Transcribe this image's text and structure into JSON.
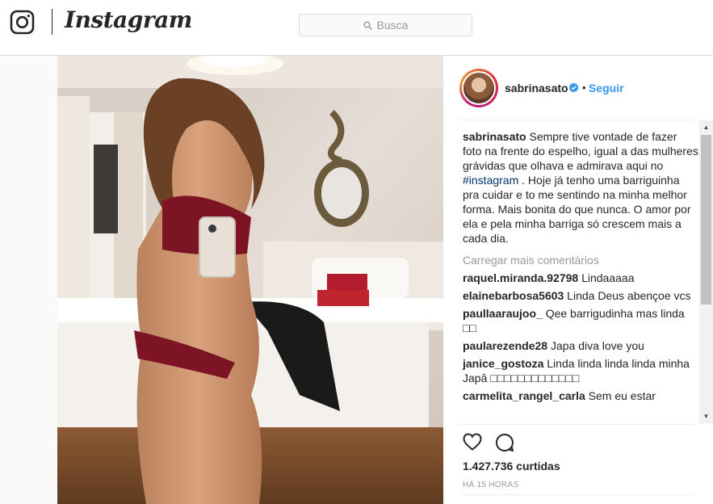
{
  "header": {
    "wordmark": "Instagram",
    "search_placeholder": "Busca"
  },
  "post": {
    "username": "sabrinasato",
    "follow_label": "Seguir",
    "separator": "•",
    "caption_user": "sabrinasato",
    "caption_text_1": " Sempre tive vontade de fazer foto na frente do espelho, igual a das mulheres grávidas que olhava e admirava aqui no ",
    "caption_hashtag": "#instagram",
    "caption_text_2": " . Hoje já tenho uma barriguinha pra cuidar e to me sentindo na minha melhor forma. Mais bonita do que nunca. O amor por ela e pela minha barriga só crescem mais a cada dia.",
    "load_more": "Carregar mais comentários",
    "comments": [
      {
        "user": "raquel.miranda.92798",
        "text": " Lindaaaaa"
      },
      {
        "user": "elainebarbosa5603",
        "text": " Linda Deus abençoe vcs"
      },
      {
        "user": "paullaaraujoo_",
        "text": " Qee barrigudinha mas linda □□"
      },
      {
        "user": "paularezende28",
        "text": " Japa diva love you"
      },
      {
        "user": "janice_gostoza",
        "text": " Linda linda linda linda minha Japâ □□□□□□□□□□□□□"
      },
      {
        "user": "carmelita_rangel_carla",
        "text": " Sem eu estar"
      }
    ],
    "likes": "1.427.736 curtidas",
    "time": "HÁ 15 HORAS"
  },
  "icons": {
    "logo": "instagram-camera-icon",
    "search": "search-icon",
    "verified": "verified-badge-icon",
    "like": "heart-icon",
    "comment": "comment-icon"
  },
  "colors": {
    "accent": "#3897f0",
    "muted": "#999999",
    "hashtag": "#003569"
  }
}
